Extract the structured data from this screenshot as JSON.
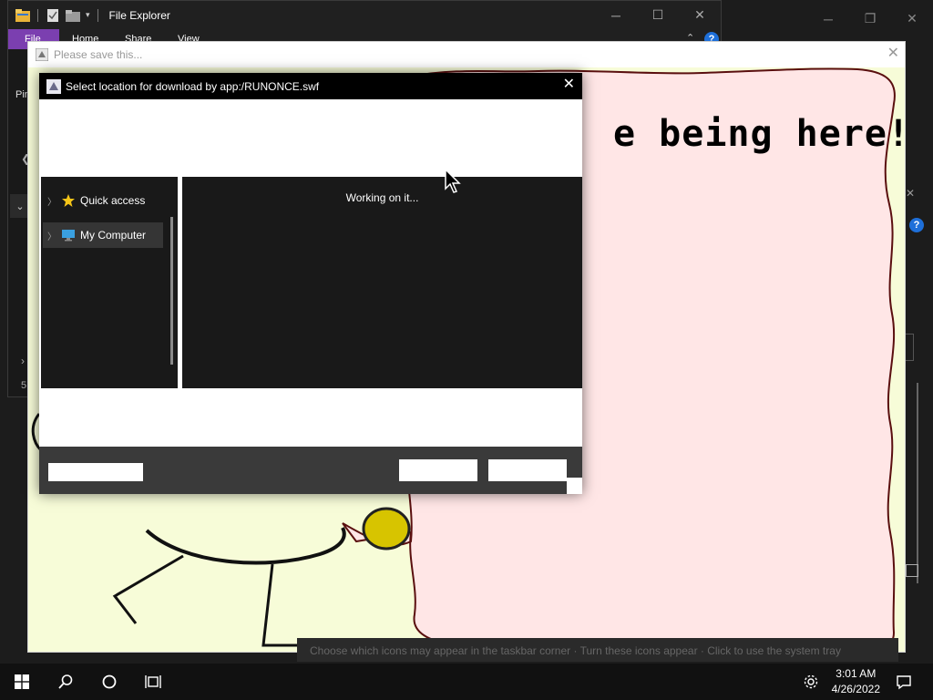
{
  "file_explorer": {
    "title": "File Explorer",
    "tabs": {
      "file": "File",
      "home": "Home",
      "share": "Share",
      "view": "View"
    },
    "pin_text": "Pin",
    "status_text": "5",
    "help_badge": "?"
  },
  "flash_window": {
    "title": "Please save this...",
    "speech_text": "e being here!"
  },
  "dialog": {
    "title": "Select location for download by app:/RUNONCE.swf",
    "nav_items": [
      {
        "label": "Quick access",
        "icon": "star-icon",
        "selected": false
      },
      {
        "label": "My Computer",
        "icon": "computer-icon",
        "selected": true
      }
    ],
    "status": "Working on it..."
  },
  "underlay": {
    "text": "Choose which icons may appear in the taskbar corner · Turn these icons appear · Click to use the system tray"
  },
  "taskbar": {
    "time": "3:01 AM",
    "date": "4/26/2022"
  },
  "colors": {
    "file_tab": "#7b3fb0",
    "flash_bg": "#f7fcd8",
    "bubble_fill": "#ffe6e6",
    "bubble_stroke": "#5a0f0f",
    "help_badge": "#1e6fd9"
  }
}
